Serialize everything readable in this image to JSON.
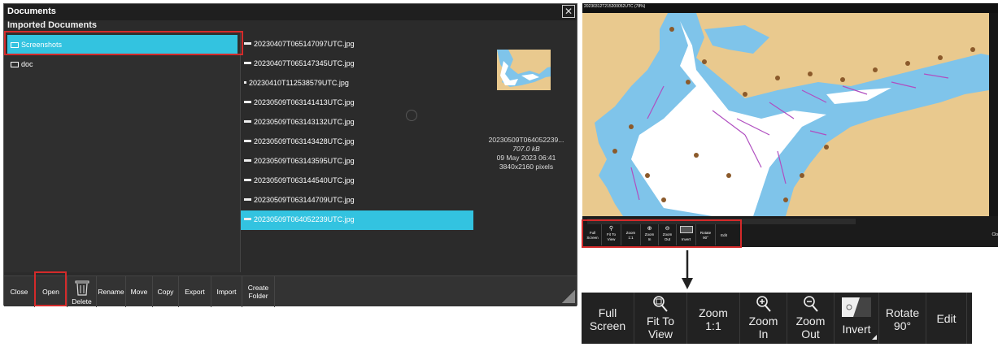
{
  "documents_window": {
    "title": "Documents",
    "subtitle": "Imported Documents",
    "folders": [
      {
        "label": "Screenshots",
        "selected": true
      },
      {
        "label": "doc",
        "selected": false
      }
    ],
    "files": [
      {
        "name": "20230407T065147097UTC.jpg",
        "selected": false
      },
      {
        "name": "20230407T065147345UTC.jpg",
        "selected": false
      },
      {
        "name": "20230410T112538579UTC.jpg",
        "selected": false
      },
      {
        "name": "20230509T063141413UTC.jpg",
        "selected": false
      },
      {
        "name": "20230509T063143132UTC.jpg",
        "selected": false
      },
      {
        "name": "20230509T063143428UTC.jpg",
        "selected": false
      },
      {
        "name": "20230509T063143595UTC.jpg",
        "selected": false
      },
      {
        "name": "20230509T063144540UTC.jpg",
        "selected": false
      },
      {
        "name": "20230509T063144709UTC.jpg",
        "selected": false
      },
      {
        "name": "20230509T064052239UTC.jpg",
        "selected": true
      }
    ],
    "preview": {
      "name": "20230509T064052239...",
      "size": "707.0 kB",
      "date": "09 May 2023 06:41",
      "dimensions": "3840x2160 pixels"
    },
    "toolbar": {
      "close": "Close",
      "open": "Open",
      "delete": "Delete",
      "rename": "Rename",
      "move": "Move",
      "copy": "Copy",
      "export": "Export",
      "import": "Import",
      "create_folder_1": "Create",
      "create_folder_2": "Folder"
    }
  },
  "chart_window": {
    "title": "20230312T215200052UTC (78%)",
    "close_label": "Clo",
    "toolbar": {
      "full_screen_1": "Full",
      "full_screen_2": "Screen",
      "fit_1": "Fit To",
      "fit_2": "View",
      "zoom11_1": "Zoom",
      "zoom11_2": "1:1",
      "zoomin_1": "Zoom",
      "zoomin_2": "In",
      "zoomout_1": "Zoom",
      "zoomout_2": "Out",
      "invert": "Invert",
      "rotate_1": "Rotate",
      "rotate_2": "90°",
      "edit": "Edit"
    }
  },
  "enlarged_toolbar": {
    "full_screen_1": "Full",
    "full_screen_2": "Screen",
    "fit_1": "Fit To",
    "fit_2": "View",
    "zoom11_1": "Zoom",
    "zoom11_2": "1:1",
    "zoomin_1": "Zoom",
    "zoomin_2": "In",
    "zoomout_1": "Zoom",
    "zoomout_2": "Out",
    "invert": "Invert",
    "rotate_1": "Rotate",
    "rotate_2": "90°",
    "edit": "Edit"
  },
  "colors": {
    "selection": "#33c3e0",
    "highlight": "#d42a2a",
    "land": "#e9c98e",
    "water": "#7fc4ea",
    "route": "#b04ec0",
    "marker": "#8b5a2b"
  }
}
